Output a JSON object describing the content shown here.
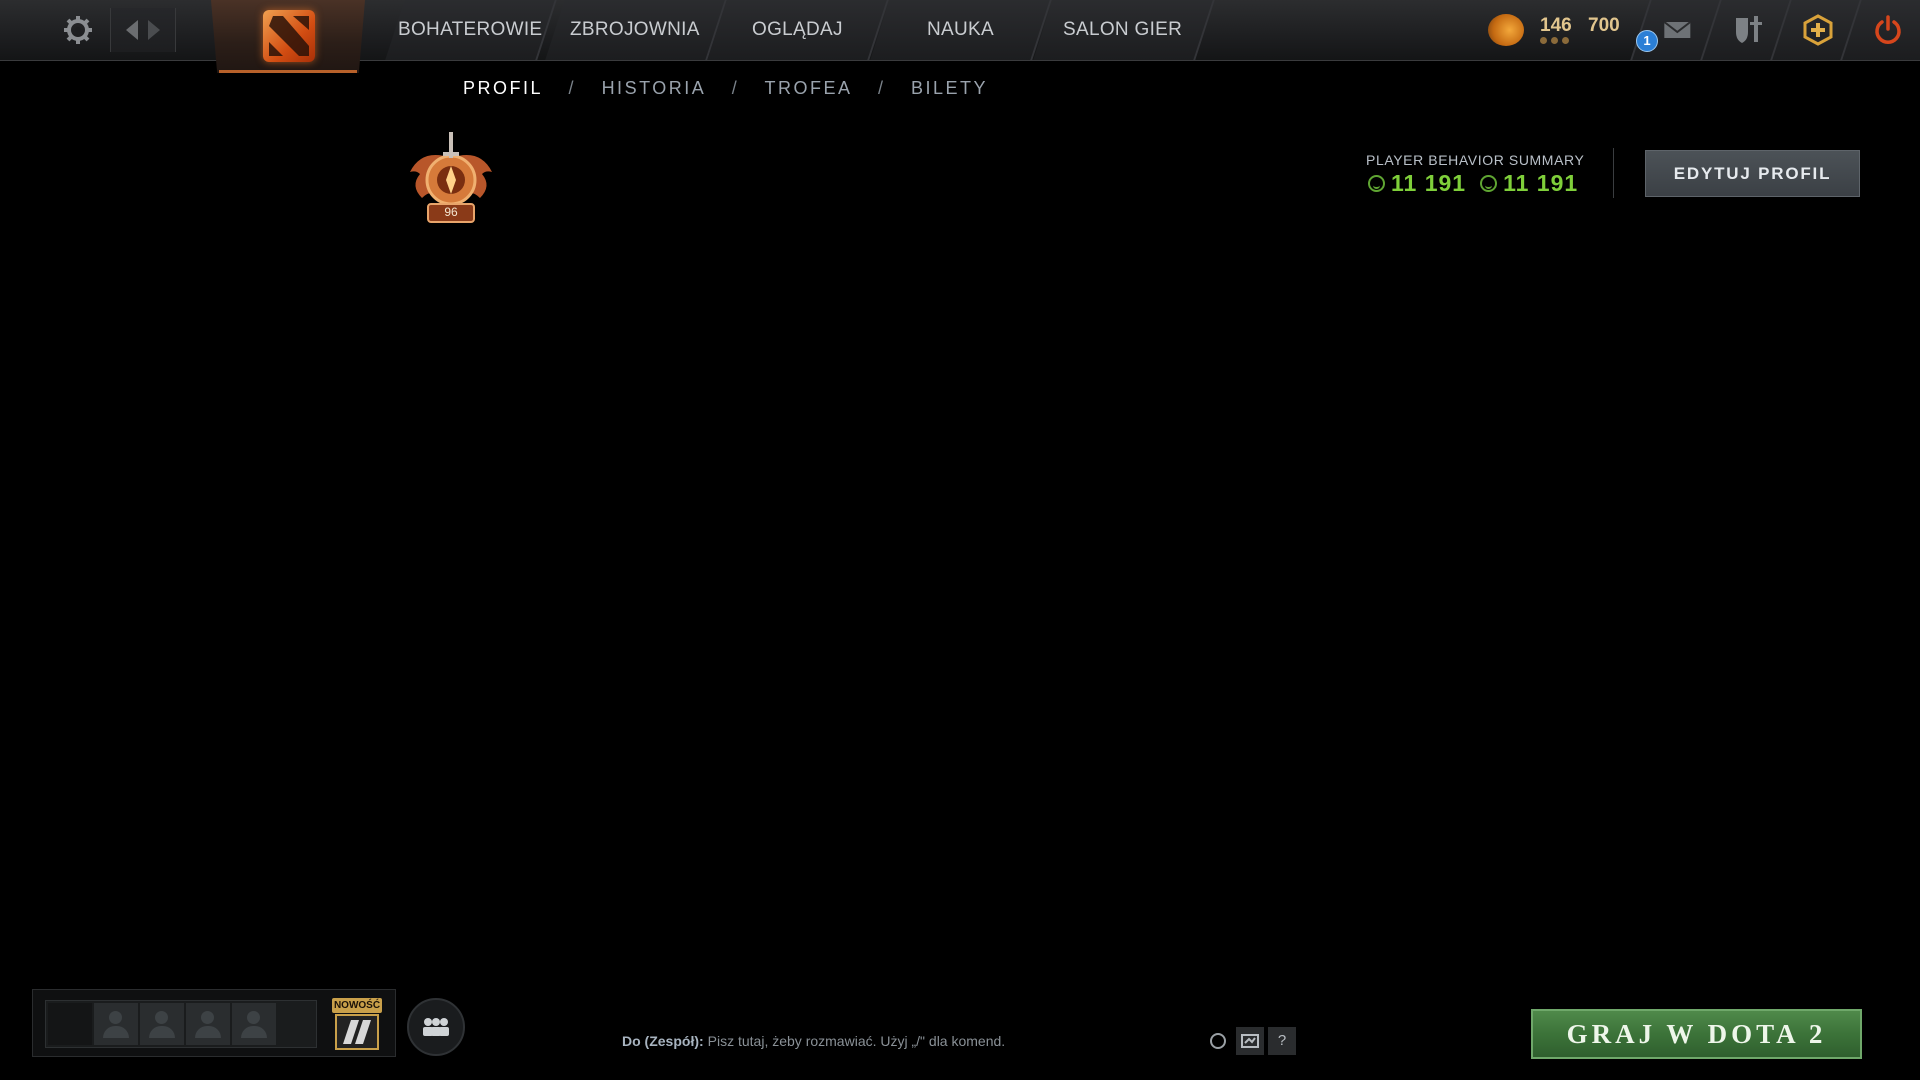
{
  "nav": {
    "tabs": [
      "BOHATEROWIE",
      "ZBROJOWNIA",
      "OGLĄDAJ",
      "NAUKA",
      "SALON GIER"
    ],
    "shards": "146",
    "gold": "700",
    "mail_badge": "1"
  },
  "subnav": {
    "items": [
      "PROFIL",
      "HISTORIA",
      "TROFEA",
      "BILETY"
    ],
    "separator": "/",
    "active": "PROFIL"
  },
  "medal": {
    "level": "96"
  },
  "behavior": {
    "title": "PLAYER BEHAVIOR SUMMARY",
    "value_1": "11 191",
    "value_2": "11 191"
  },
  "edit_button": "EDYTUJ PROFIL",
  "party": {
    "new_label": "NOWOŚĆ"
  },
  "chat": {
    "channel": "Do (Zespół):",
    "placeholder": "Pisz tutaj, żeby rozmawiać. Użyj „/\" dla komend.",
    "help": "?"
  },
  "play_button": "GRAJ W DOTA 2",
  "colors": {
    "accent_orange": "#d24d12",
    "behavior_green": "#7fcf3a",
    "play_green": "#3c7339"
  }
}
